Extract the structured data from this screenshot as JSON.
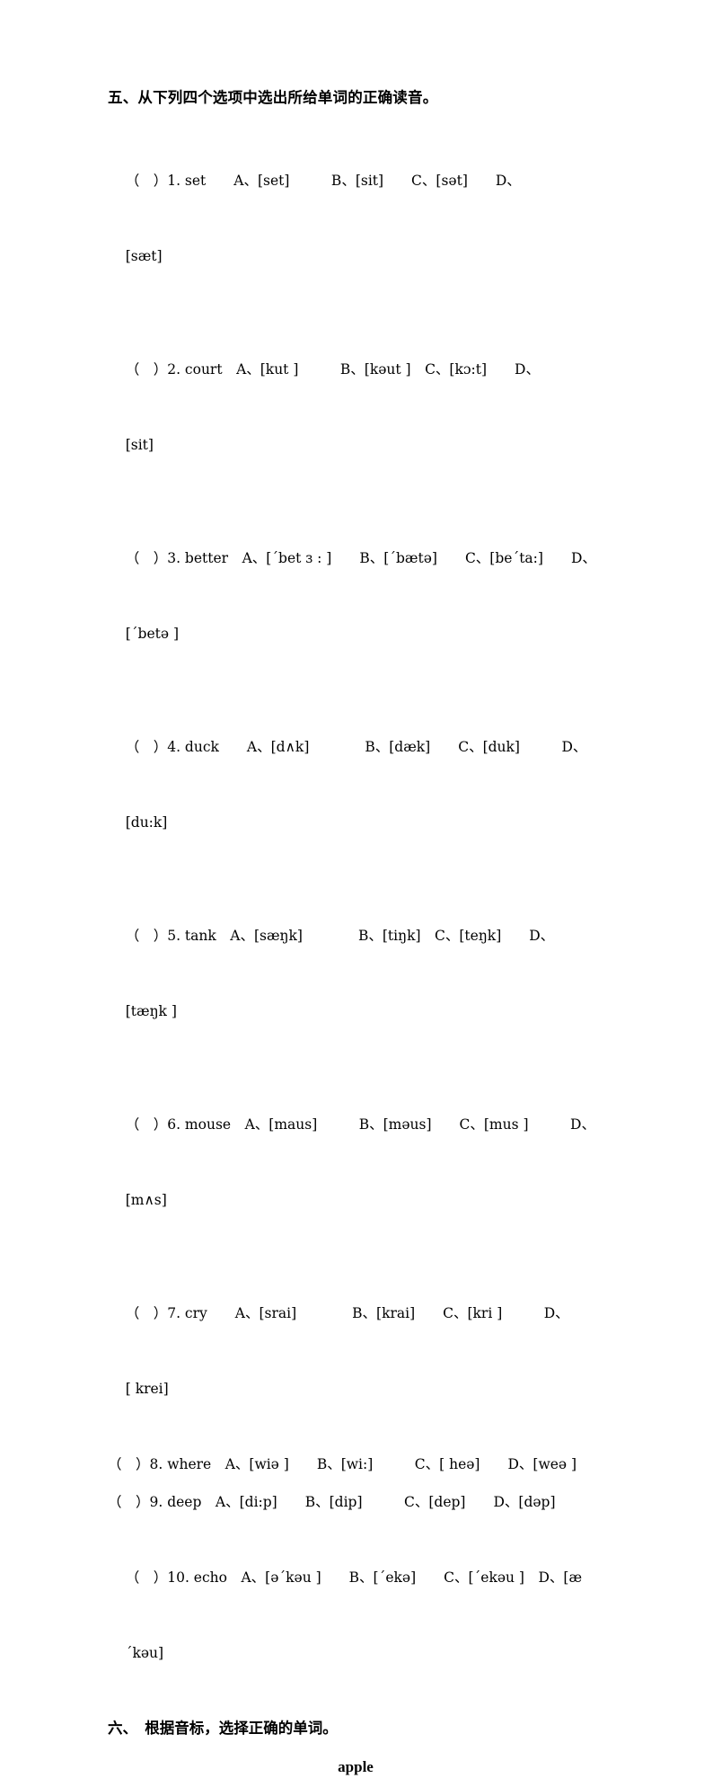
{
  "document": {
    "page_background": "#ffffff",
    "text_color": "#000000"
  },
  "section_five": {
    "heading": "五、从下列四个选项中选出所给单词的正确读音。",
    "questions": [
      {
        "bracket": "（　）",
        "number": "1.",
        "word": "set",
        "line1": "（　）1. set　　A、[set]　　　B、[sit]　　C、[sət]　　D、",
        "line2": "[sæt]"
      },
      {
        "bracket": "（　）",
        "number": "2.",
        "word": "court",
        "line1": "（　）2. court　A、[kut ]　　　B、[kəut ]　C、[kɔ:t]　　D、",
        "line2": "[sit]"
      },
      {
        "bracket": "（　）",
        "number": "3.",
        "word": "better",
        "line1": "（　）3. better　A、[ˊbet ɜ : ]　　B、[ˊbætə]　　C、[beˊta:]　　D、",
        "line2": "[ˊbetə ]"
      },
      {
        "bracket": "（　）",
        "number": "4.",
        "word": "duck",
        "line1": "（　）4. duck　　A、[d∧k]　　　　B、[dæk]　　C、[duk]　　　D、",
        "line2": "[du:k]"
      },
      {
        "bracket": "（　）",
        "number": "5.",
        "word": "tank",
        "line1": "（　）5. tank　A、[sæŋk]　　　　B、[tiŋk]　C、[teŋk]　　D、",
        "line2": "[tæŋk ]"
      },
      {
        "bracket": "（　）",
        "number": "6.",
        "word": "mouse",
        "line1": "（　）6. mouse　A、[maus]　　　B、[məus]　　C、[mus ]　　　D、",
        "line2": "[m∧s]"
      },
      {
        "bracket": "（　）",
        "number": "7.",
        "word": "cry",
        "line1": "（　）7. cry　　A、[srai]　　　　B、[krai]　　C、[kri ]　　　D、",
        "line2": "[ krei]"
      }
    ],
    "questions_compact": [
      {
        "number": "8.",
        "word": "where",
        "line": "（　）8. where　A、[wiə ]　　B、[wi:]　　　C、[ heə]　　D、[weə ]"
      },
      {
        "number": "9.",
        "word": "deep",
        "line": "（　）9. deep　A、[di:p]　　B、[dip]　　　C、[dep]　　D、[dəp]"
      }
    ],
    "question_ten": {
      "number": "10.",
      "word": "echo",
      "line1": "（　）10. echo　A、[əˊkəu ]　　B、[ˊekə]　　C、[ˊekəu ]　D、[æ",
      "line2": "ˊkəu]"
    }
  },
  "section_six": {
    "heading": "六、　根据音标，选择正确的单词。",
    "word": "apple"
  }
}
